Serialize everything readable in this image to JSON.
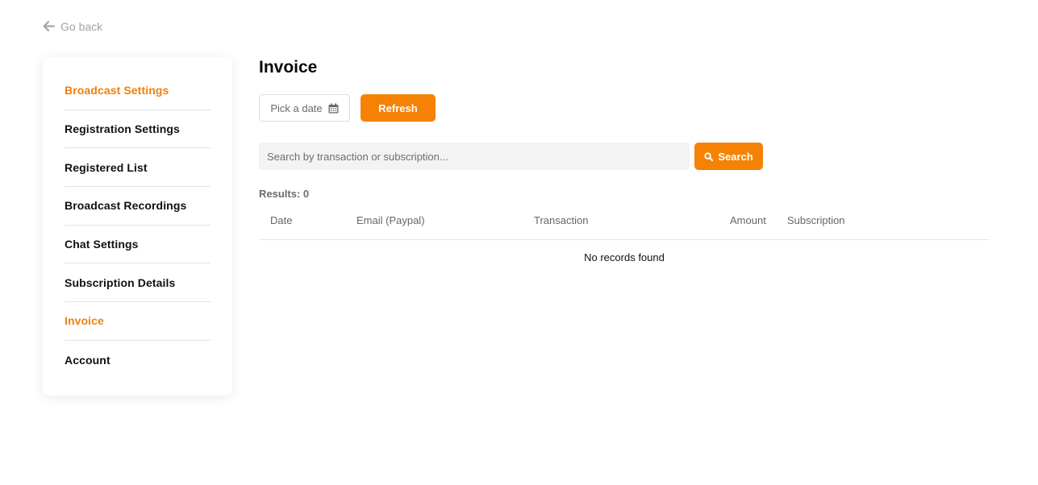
{
  "nav": {
    "go_back_label": "Go back"
  },
  "sidebar": {
    "items": [
      {
        "label": "Broadcast Settings"
      },
      {
        "label": "Registration Settings"
      },
      {
        "label": "Registered List"
      },
      {
        "label": "Broadcast Recordings"
      },
      {
        "label": "Chat Settings"
      },
      {
        "label": "Subscription Details"
      },
      {
        "label": "Invoice"
      },
      {
        "label": "Account"
      }
    ]
  },
  "main": {
    "title": "Invoice",
    "date_picker_label": "Pick a date",
    "refresh_label": "Refresh",
    "search": {
      "placeholder": "Search by transaction or subscription...",
      "value": "",
      "button_label": "Search"
    },
    "results_label": "Results: 0",
    "table": {
      "columns": [
        "Date",
        "Email (Paypal)",
        "Transaction",
        "Amount",
        "Subscription"
      ],
      "rows": [],
      "empty_text": "No records found"
    }
  },
  "colors": {
    "accent": "#f58205",
    "active_text": "#f07f0c"
  },
  "icons": {
    "back": "arrow-left-icon",
    "calendar": "calendar-icon",
    "search": "search-icon"
  }
}
